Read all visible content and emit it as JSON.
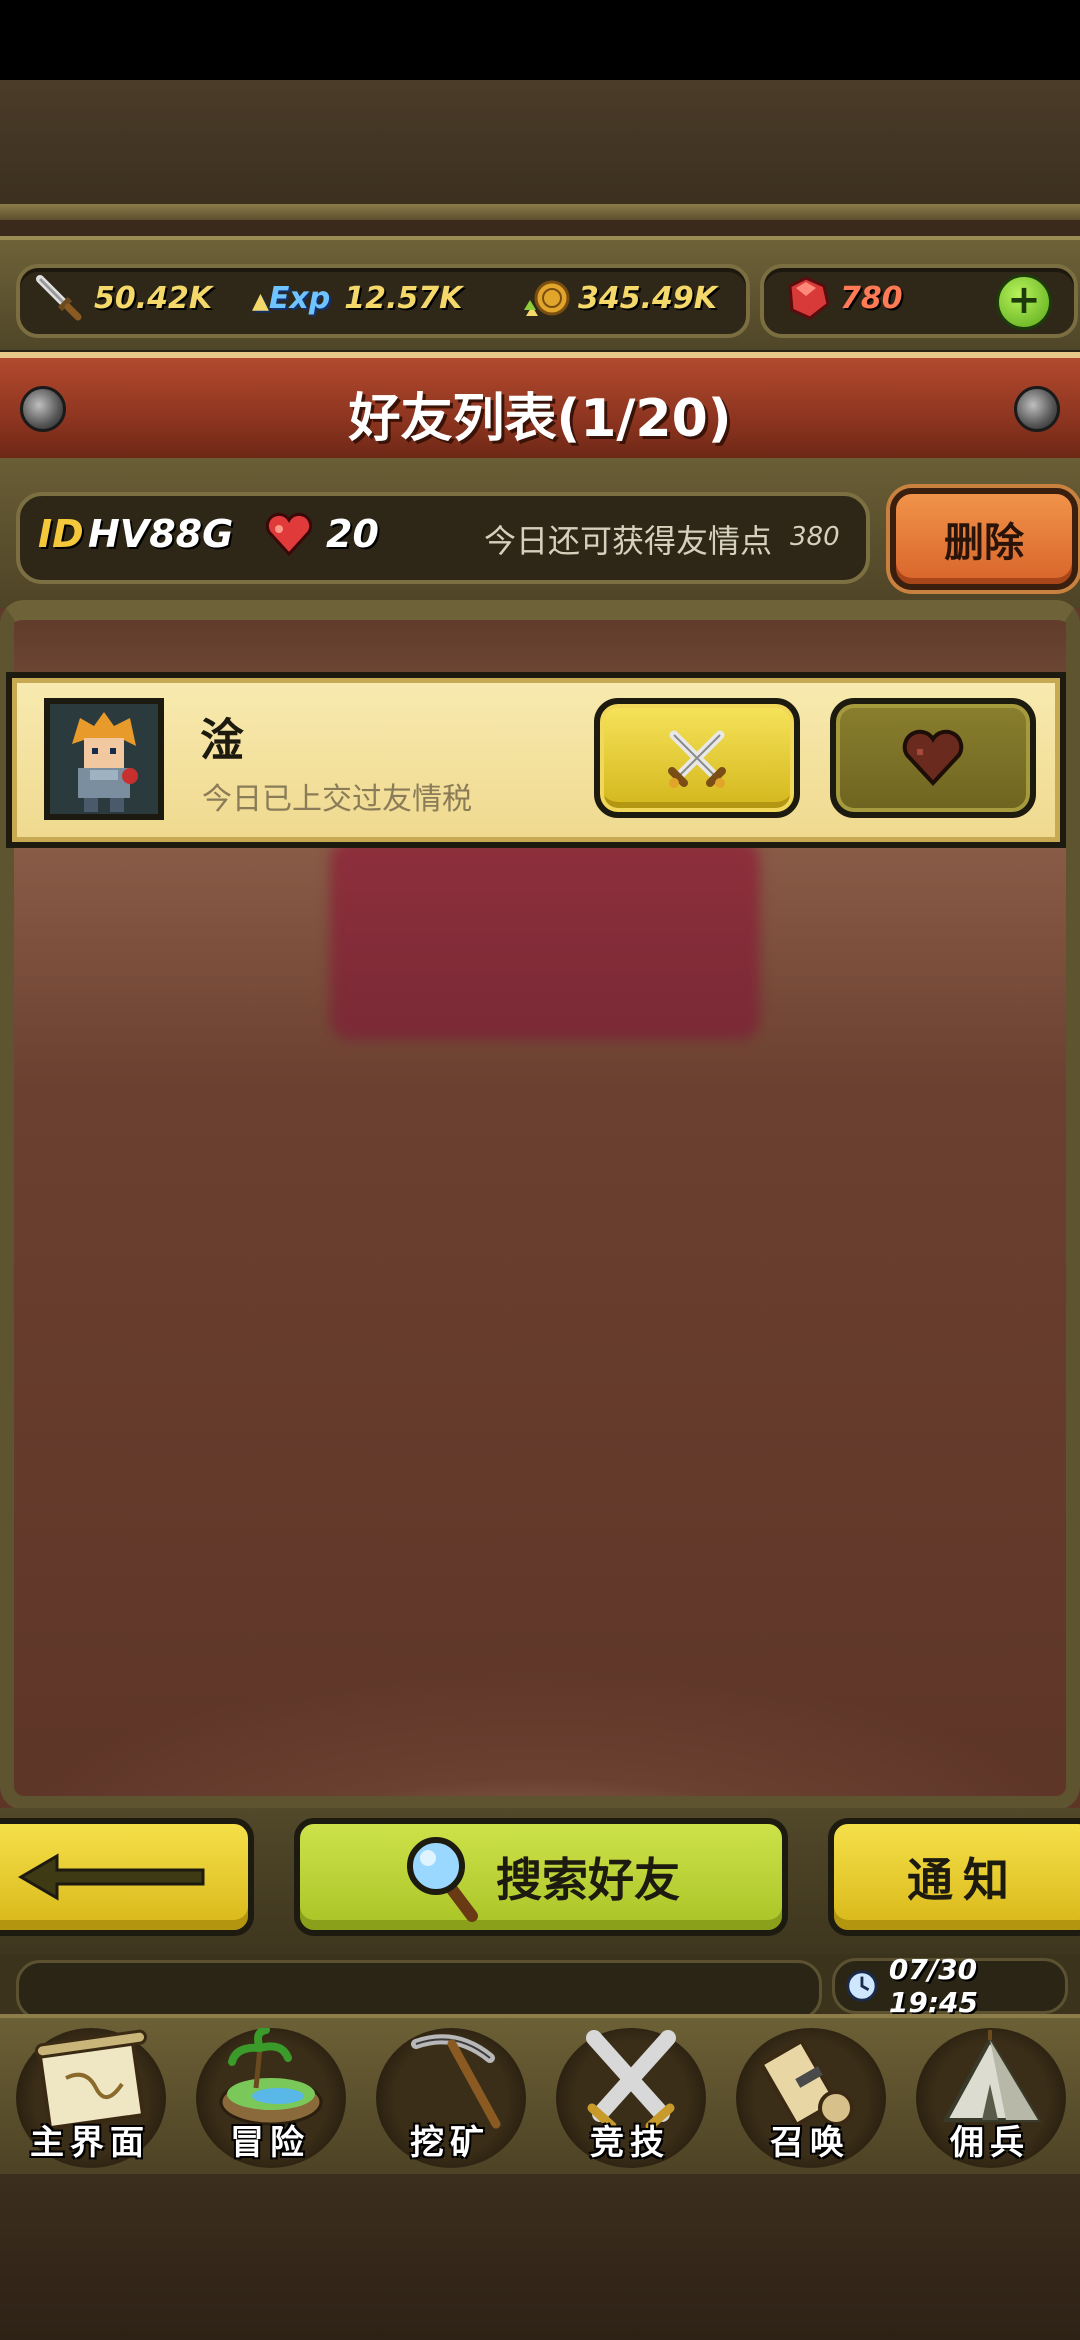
{
  "resources": {
    "attack": "50.42K",
    "exp_icon_label": "Exp",
    "exp": "12.57K",
    "gold": "345.49K",
    "gems": "780"
  },
  "title": "好友列表(1/20)",
  "info": {
    "id_label": "ID",
    "id_value": "HV88G",
    "hearts": "20",
    "friendship_text": "今日还可获得友情点",
    "friendship_points": "380",
    "delete_label": "删除"
  },
  "friends": [
    {
      "name": "淦",
      "status": "今日已上交过友情税"
    }
  ],
  "actions": {
    "search_label": "搜索好友",
    "notice_label": "通知"
  },
  "clock": "07/30 19:45",
  "nav": [
    {
      "label": "主界面",
      "icon": "scroll-map-icon"
    },
    {
      "label": "冒险",
      "icon": "island-icon"
    },
    {
      "label": "挖矿",
      "icon": "pickaxe-icon"
    },
    {
      "label": "竞技",
      "icon": "crossed-swords-icon"
    },
    {
      "label": "召唤",
      "icon": "summon-scroll-icon"
    },
    {
      "label": "佣兵",
      "icon": "tent-icon"
    }
  ],
  "colors": {
    "title_banner": "#8e3520",
    "card_bg": "#f8eab0",
    "resource_text": "#f4d96a",
    "gem_text": "#ff7a55"
  }
}
